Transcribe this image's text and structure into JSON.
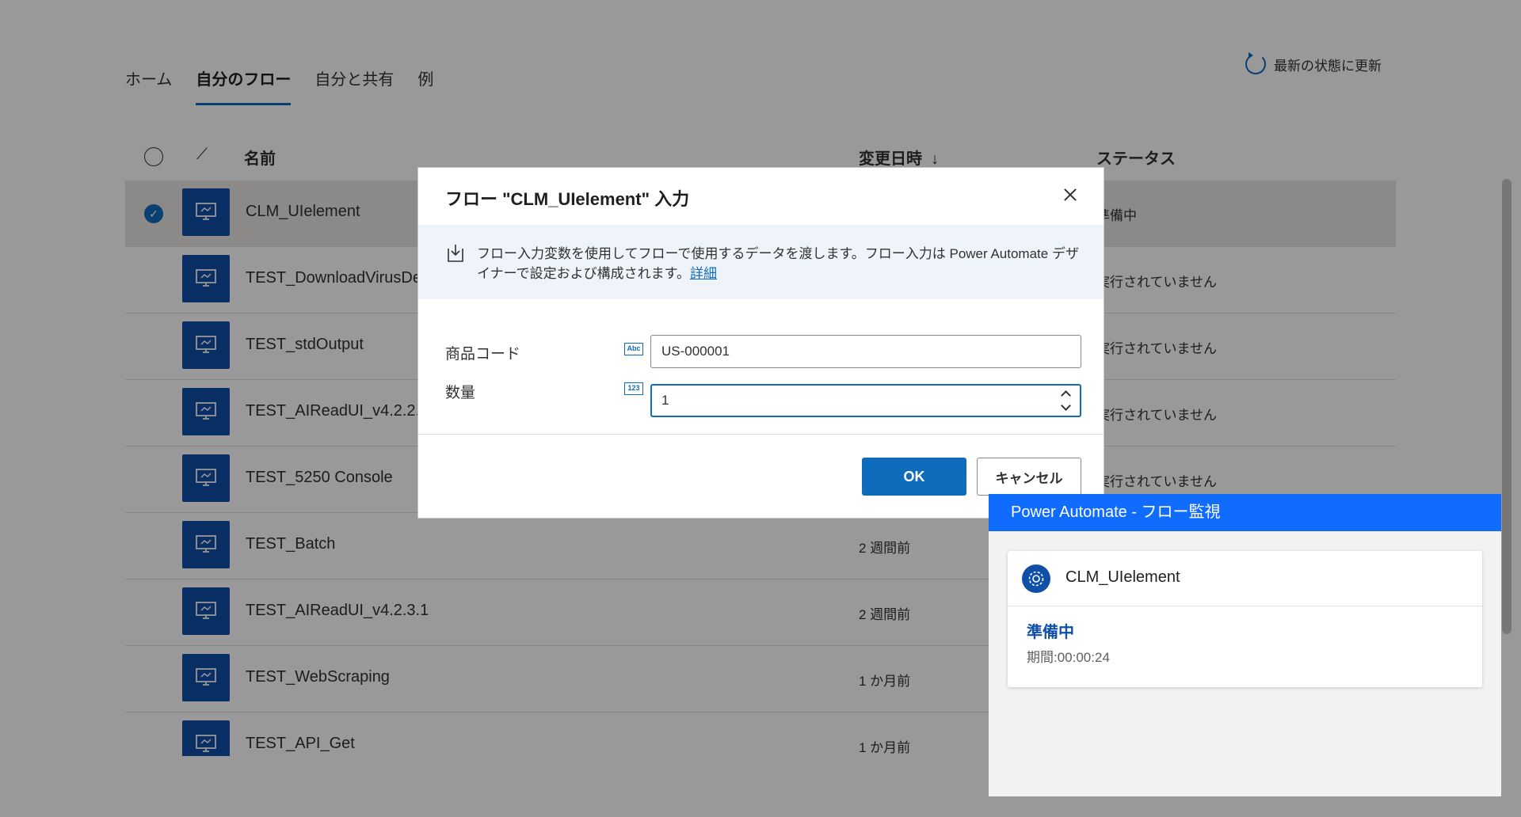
{
  "tabs": [
    {
      "label": "ホーム"
    },
    {
      "label": "自分のフロー"
    },
    {
      "label": "自分と共有"
    },
    {
      "label": "例"
    }
  ],
  "refresh_label": "最新の状態に更新",
  "columns": {
    "name": "名前",
    "modified": "変更日時",
    "sort_arrow": "↓",
    "status": "ステータス"
  },
  "flows": [
    {
      "name": "CLM_UIelement",
      "modified": "",
      "status": "準備中",
      "selected": true
    },
    {
      "name": "TEST_DownloadVirusDe",
      "modified": "",
      "status": "実行されていません"
    },
    {
      "name": "TEST_stdOutput",
      "modified": "",
      "status": "実行されていません"
    },
    {
      "name": "TEST_AIReadUI_v4.2.2.0",
      "modified": "",
      "status": "実行されていません"
    },
    {
      "name": "TEST_5250 Console",
      "modified": "",
      "status": "実行されていません"
    },
    {
      "name": "TEST_Batch",
      "modified": "2 週間前",
      "status": ""
    },
    {
      "name": "TEST_AIReadUI_v4.2.3.1",
      "modified": "2 週間前",
      "status": ""
    },
    {
      "name": "TEST_WebScraping",
      "modified": "1 か月前",
      "status": ""
    },
    {
      "name": "TEST_API_Get",
      "modified": "1 か月前",
      "status": ""
    }
  ],
  "dialog": {
    "title": "フロー \"CLM_UIelement\" 入力",
    "info_text": "フロー入力変数を使用してフローで使用するデータを渡します。フロー入力は Power Automate デザイナーで設定および構成されます。",
    "info_link": "詳細",
    "fields": [
      {
        "label": "商品コード",
        "type": "Abc",
        "value": "US-000001"
      },
      {
        "label": "数量",
        "type": "123",
        "value": "1"
      }
    ],
    "ok_label": "OK",
    "cancel_label": "キャンセル"
  },
  "monitor": {
    "title": "Power Automate - フロー監視",
    "flow_name": "CLM_UIelement",
    "status": "準備中",
    "duration": "期間:00:00:24"
  },
  "colors": {
    "accent": "#0f6cbd",
    "monitor_header": "#0f6cff",
    "flow_icon": "#0f4fa8"
  }
}
